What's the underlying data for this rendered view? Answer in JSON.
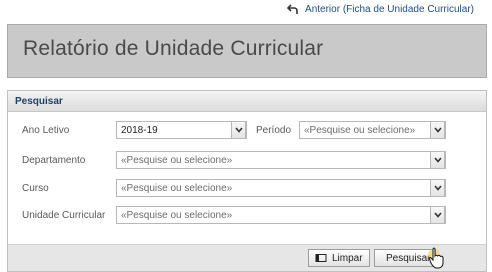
{
  "header": {
    "back_link": "Anterior (Ficha de Unidade Curricular)"
  },
  "page": {
    "title": "Relatório de Unidade Curricular"
  },
  "search_panel": {
    "title": "Pesquisar",
    "fields": {
      "ano_letivo": {
        "label": "Ano Letivo",
        "value": "2018-19"
      },
      "periodo": {
        "label": "Período",
        "placeholder": "«Pesquise ou selecione»"
      },
      "departamento": {
        "label": "Departamento",
        "placeholder": "«Pesquise ou selecione»"
      },
      "curso": {
        "label": "Curso",
        "placeholder": "«Pesquise ou selecione»"
      },
      "unidade_curricular": {
        "label": "Unidade Curricular",
        "placeholder": "«Pesquise ou selecione»"
      }
    },
    "buttons": {
      "clear": "Limpar",
      "search": "Pesquisar"
    }
  },
  "colors": {
    "link": "#1f4f86",
    "title_bg": "#c9c9c9",
    "panel_header_text": "#1f3f6a"
  }
}
